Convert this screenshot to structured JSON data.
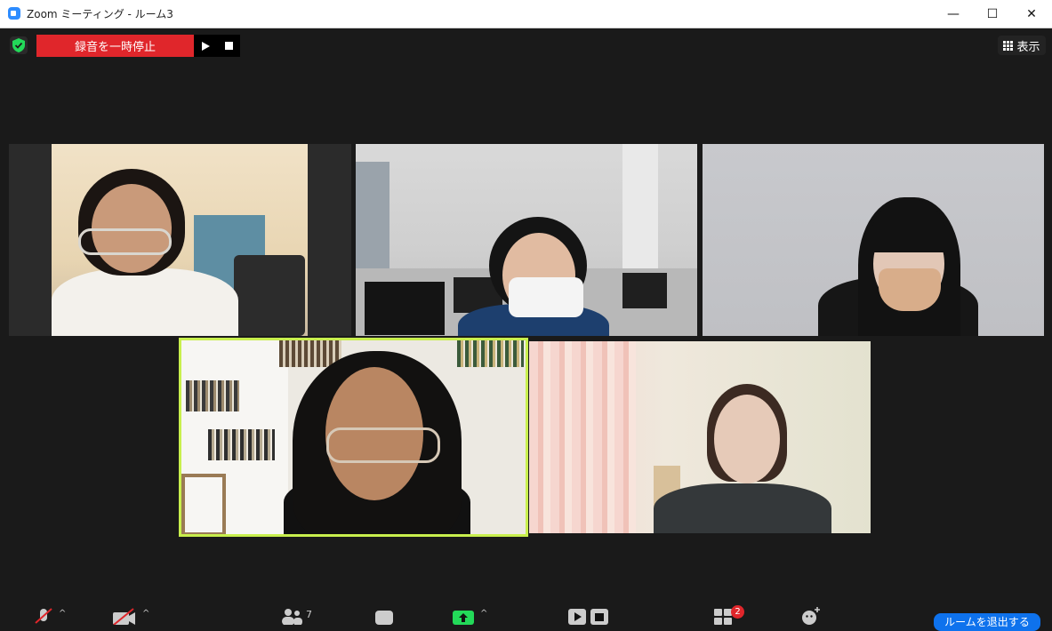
{
  "window": {
    "title": "Zoom ミーティング - ルーム3",
    "minimize": "—",
    "maximize": "☐",
    "close": "✕"
  },
  "top_controls": {
    "security_icon": "shield-check-icon",
    "recording_label": "録音を一時停止",
    "play_icon": "play-icon",
    "stop_icon": "stop-icon",
    "view_label": "表示"
  },
  "participants": [
    {
      "tile": 1,
      "active_speaker": false
    },
    {
      "tile": 2,
      "active_speaker": false
    },
    {
      "tile": 3,
      "active_speaker": false
    },
    {
      "tile": 4,
      "active_speaker": true
    },
    {
      "tile": 5,
      "active_speaker": false
    }
  ],
  "toolbar": {
    "participants_count": "7",
    "breakout_badge": "2",
    "leave_label": "ルームを退出する",
    "colors": {
      "accent": "#0e72ed",
      "record": "#e0262b",
      "speaker_border": "#c8ef4d",
      "share": "#23d959"
    }
  }
}
